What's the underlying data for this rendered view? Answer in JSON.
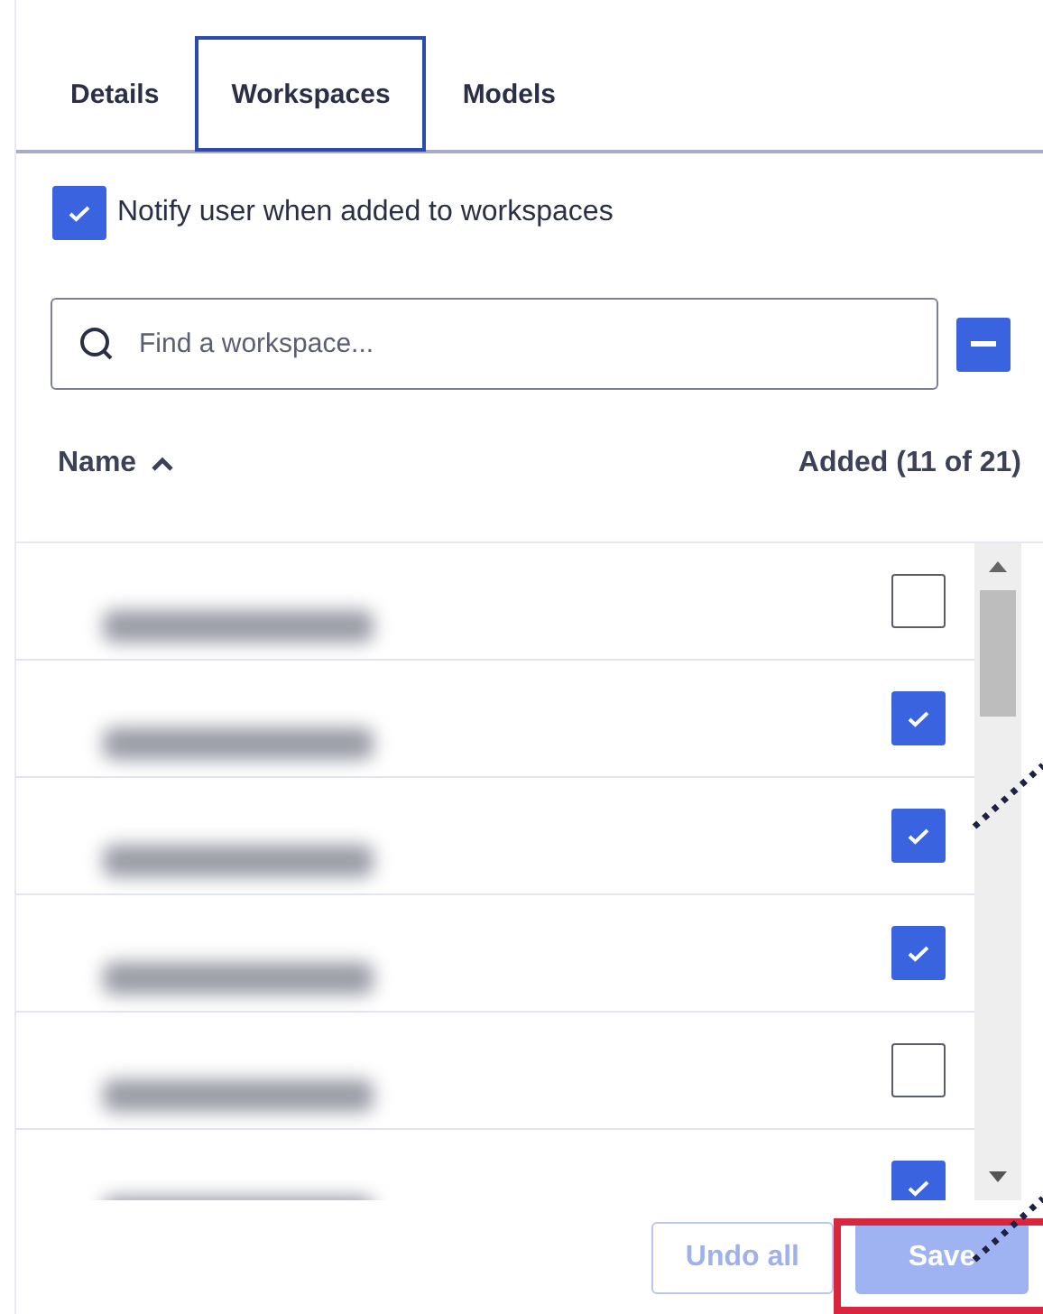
{
  "tabs": [
    {
      "label": "Details",
      "selected": false
    },
    {
      "label": "Workspaces",
      "selected": true
    },
    {
      "label": "Models",
      "selected": false
    }
  ],
  "notify": {
    "label": "Notify user when added to workspaces",
    "checked": true
  },
  "search": {
    "placeholder": "Find a workspace..."
  },
  "table": {
    "columns": [
      {
        "label": "Name",
        "sorted_ascending": true
      },
      {
        "label": "Added (11 of 21)"
      }
    ],
    "rows": [
      {
        "checked": false
      },
      {
        "checked": true
      },
      {
        "checked": true
      },
      {
        "checked": true
      },
      {
        "checked": false
      },
      {
        "checked": true
      }
    ]
  },
  "buttons": [
    {
      "label": "Undo all",
      "kind": "secondary",
      "disabled": true
    },
    {
      "label": "Save",
      "kind": "primary",
      "disabled": true
    }
  ]
}
